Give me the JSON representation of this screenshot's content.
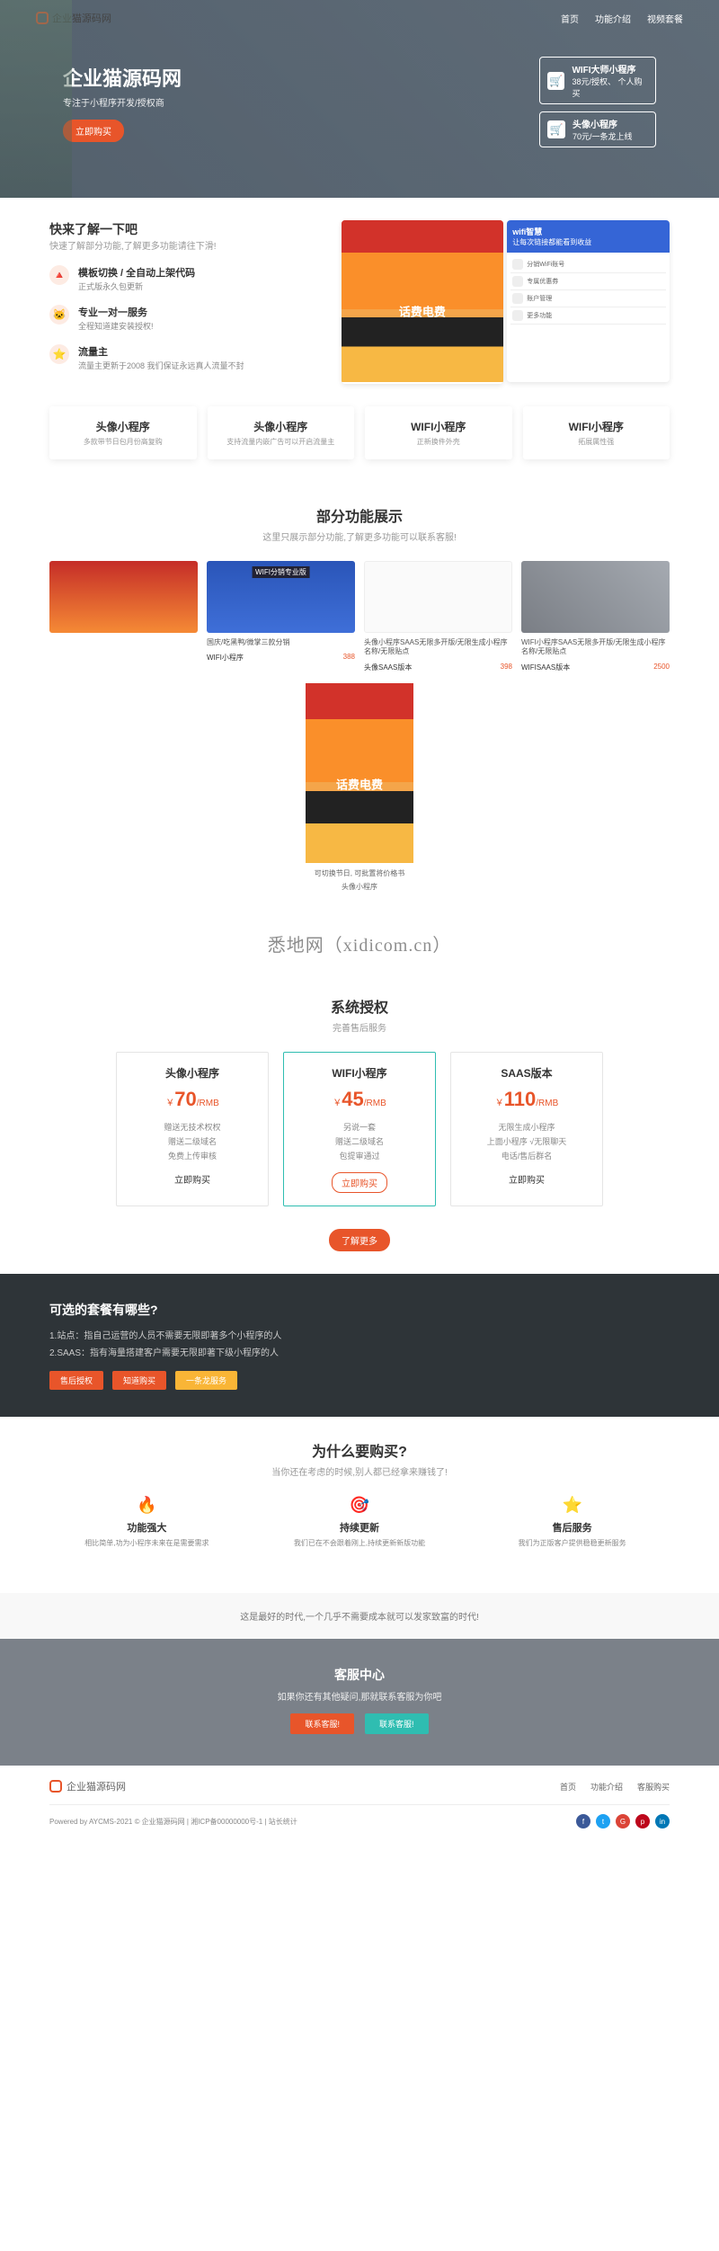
{
  "logo_text": "企业猫源码网",
  "nav": [
    "首页",
    "功能介绍",
    "视频套餐"
  ],
  "hero": {
    "title": "企业猫源码网",
    "subtitle": "专注于小程序开发/授权商",
    "cta": "立即购买",
    "card1_title": "WIFI大师小程序",
    "card1_sub1": "38元/授权、",
    "card1_sub2": "个人购买",
    "card2_title": "头像小程序",
    "card2_sub1": "70元/一条龙上线"
  },
  "quick": {
    "title": "快来了解一下吧",
    "sub": "快速了解部分功能,了解更多功能请往下滑!",
    "f1_title": "模板切换 / 全自动上架代码",
    "f1_desc": "正式版永久包更新",
    "f2_title": "专业一对一服务",
    "f2_desc": "全程知道建安装授权!",
    "f3_title": "流量主",
    "f3_desc": "流量主更新于2008 我们保证永远真人流量不封",
    "mock2_title": "wifi智慧",
    "mock2_sub": "让每次链接都能看到收益",
    "mock2_row1": "分销WiFi账号",
    "mock2_row2": "专属优惠券",
    "mock2_row3": "账户管理",
    "mock2_row4": "更多功能"
  },
  "cards4": [
    {
      "title": "头像小程序",
      "desc": "多款带节日包月份高复购"
    },
    {
      "title": "头像小程序",
      "desc": "支持流量内嵌广告可以开启流量主"
    },
    {
      "title": "WIFI小程序",
      "desc": "正新换件外壳"
    },
    {
      "title": "WIFI小程序",
      "desc": "拓展属性强"
    }
  ],
  "showcase": {
    "title": "部分功能展示",
    "sub": "这里只展示部分功能,了解更多功能可以联系客服!",
    "items": [
      {
        "title": "国庆/吃黑鸭/微掌三款分销",
        "label": "WIFI小程序",
        "price": "388"
      },
      {
        "title": "头像小程序SAAS无限多开版/无限生成小程序名称/无限贴点",
        "label": "头像SAAS版本",
        "price": "398"
      },
      {
        "title": "WIFI小程序SAAS无限多开版/无限生成小程序名称/无限贴点",
        "label": "WIFISAAS版本",
        "price": "2500"
      }
    ],
    "big_title": "可切换节日, 可批置将价格书",
    "big_label": "头像小程序"
  },
  "watermark": "悉地网（xidicom.cn）",
  "auth": {
    "title": "系统授权",
    "sub": "完善售后服务",
    "plans": [
      {
        "name": "头像小程序",
        "price": "70",
        "unit": "/RMB",
        "features": [
          "赠送无技术权权",
          "赠送二级域名",
          "免费上传审核"
        ],
        "cta": "立即购买"
      },
      {
        "name": "WIFI小程序",
        "price": "45",
        "unit": "/RMB",
        "features": [
          "另说一套",
          "赠送二级域名",
          "包提审通过"
        ],
        "cta": "立即购买"
      },
      {
        "name": "SAAS版本",
        "price": "110",
        "unit": "/RMB",
        "features": [
          "无限生成小程序",
          "上面小程序 √无限聊天",
          "电话/售后群名"
        ],
        "cta": "立即购买"
      }
    ],
    "more": "了解更多"
  },
  "dark": {
    "title": "可选的套餐有哪些?",
    "l1": "1.站点：指自己运营的人员不需要无限即著多个小程序的人",
    "l2": "2.SAAS：指有海量搭建客户需要无限即著下级小程序的人",
    "btns": [
      "售后授权",
      "知道购买",
      "一条龙服务"
    ]
  },
  "why": {
    "title": "为什么要购买?",
    "sub": "当你还在考虑的时候,别人都已经拿来赚钱了!",
    "items": [
      {
        "icon": "🔥",
        "title": "功能强大",
        "desc": "相比简单,功为小程序未来在是需要需求"
      },
      {
        "icon": "🎯",
        "title": "持续更新",
        "desc": "我们已在不会跟着刚上,持续更新新版功能"
      },
      {
        "icon": "⭐",
        "title": "售后服务",
        "desc": "我们为正版客户提供稳稳更新服务"
      }
    ],
    "bar": "这是最好的时代,一个几乎不需要成本就可以发家致富的时代!"
  },
  "contact": {
    "title": "客服中心",
    "sub": "如果你还有其他疑问,那就联系客服为你吧",
    "btn1": "联系客服!",
    "btn2": "联系客服!"
  },
  "footer": {
    "nav": [
      "首页",
      "功能介绍",
      "客服购买"
    ],
    "copyright": "Powered by AYCMS-2021 © 企业猫源码网 | 湘ICP备00000000号-1 | 站长统计"
  }
}
